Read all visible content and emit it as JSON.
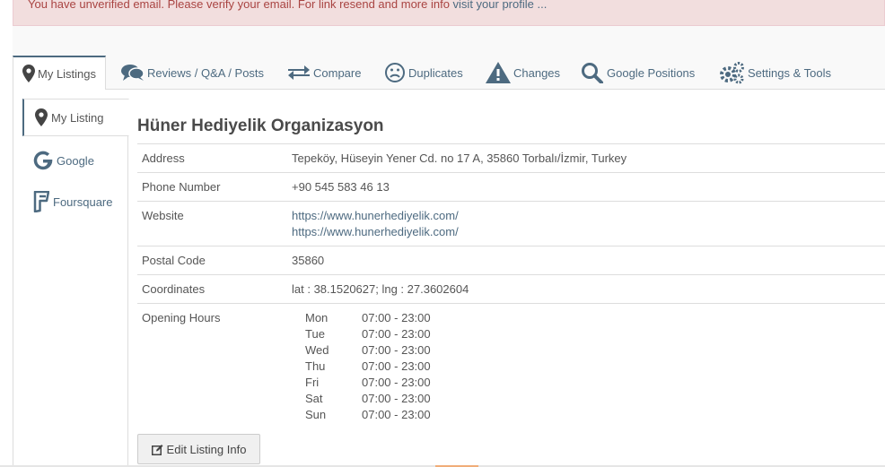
{
  "alert": {
    "text": "You have unverified email. Please verify your email. For link resend and more info ",
    "link": "visit your profile ..."
  },
  "tabs": [
    {
      "label": "My Listings",
      "icon": "map-marker-icon",
      "active": true
    },
    {
      "label": "Reviews / Q&A / Posts",
      "icon": "comments-icon"
    },
    {
      "label": "Compare",
      "icon": "exchange-icon"
    },
    {
      "label": "Duplicates",
      "icon": "frown-icon"
    },
    {
      "label": "Changes",
      "icon": "warning-icon"
    },
    {
      "label": "Google Positions",
      "icon": "search-icon"
    },
    {
      "label": "Settings & Tools",
      "icon": "gears-icon"
    }
  ],
  "sidenav": [
    {
      "label": "My Listing",
      "icon": "map-marker-icon",
      "active": true
    },
    {
      "label": "Google",
      "icon": "google-icon"
    },
    {
      "label": "Foursquare",
      "icon": "foursquare-icon"
    }
  ],
  "listing": {
    "title": "Hüner Hediyelik Organizasyon",
    "rows": {
      "address": {
        "label": "Address",
        "value": "Tepeköy, Hüseyin Yener Cd. no 17 A, 35860 Torbalı/İzmir, Turkey"
      },
      "phone": {
        "label": "Phone Number",
        "value": "+90 545 583 46 13"
      },
      "website": {
        "label": "Website",
        "links": [
          "https://www.hunerhediyelik.com/",
          "https://www.hunerhediyelik.com/"
        ]
      },
      "postal": {
        "label": "Postal Code",
        "value": "35860"
      },
      "coords": {
        "label": "Coordinates",
        "value": "lat : 38.1520627; lng : 27.3602604"
      },
      "hours": {
        "label": "Opening Hours",
        "days": [
          {
            "day": "Mon",
            "time": "07:00 - 23:00"
          },
          {
            "day": "Tue",
            "time": "07:00 - 23:00"
          },
          {
            "day": "Wed",
            "time": "07:00 - 23:00"
          },
          {
            "day": "Thu",
            "time": "07:00 - 23:00"
          },
          {
            "day": "Fri",
            "time": "07:00 - 23:00"
          },
          {
            "day": "Sat",
            "time": "07:00 - 23:00"
          },
          {
            "day": "Sun",
            "time": "07:00 - 23:00"
          }
        ]
      }
    },
    "edit_label": "Edit Listing Info"
  },
  "colors": {
    "link": "#4d6a80",
    "alert_bg": "#f2dede",
    "alert_text": "#a94442"
  }
}
